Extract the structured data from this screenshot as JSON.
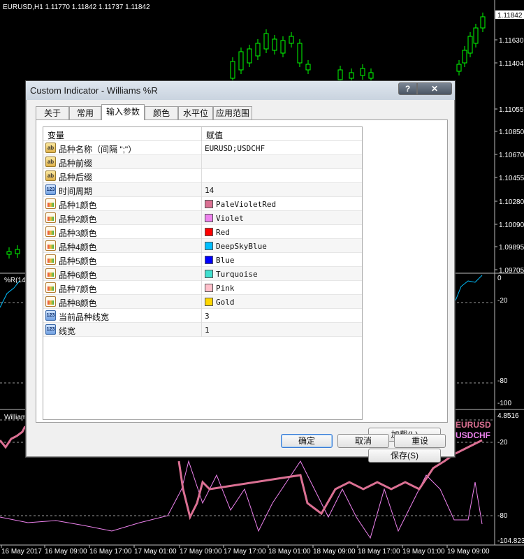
{
  "chart": {
    "header": "EURUSD,H1  1.11770 1.11842 1.11737 1.11842",
    "current_price": "1.11842",
    "price_ticks": [
      "1.11630",
      "1.11404",
      "1.11055",
      "1.10850",
      "1.10670",
      "1.10455",
      "1.10280",
      "1.10090",
      "1.09895",
      "1.09705"
    ],
    "sub1": {
      "label": "%R(14)",
      "ticks": [
        "0",
        "-20",
        "-80",
        "-100"
      ]
    },
    "sub2": {
      "label": "Williams",
      "ticks": [
        "4.8516",
        "-20",
        "-80",
        "-104.8233"
      ],
      "legend1": "EURUSD",
      "legend2": "USDCHF"
    },
    "dates": [
      "16 May 2017",
      "16 May 09:00",
      "16 May 17:00",
      "17 May 01:00",
      "17 May 09:00",
      "17 May 17:00",
      "18 May 01:00",
      "18 May 09:00",
      "18 May 17:00",
      "19 May 01:00",
      "19 May 09:00"
    ]
  },
  "dialog": {
    "title": "Custom Indicator - Williams %R",
    "help_label": "?",
    "close_label": "✕",
    "tabs": [
      "关于",
      "常用",
      "输入参数",
      "颜色",
      "水平位",
      "应用范围"
    ],
    "active_tab": "输入参数",
    "columns": {
      "variable": "变量",
      "value": "赋值"
    },
    "params": [
      {
        "icon": "text",
        "name": "品种名称（间隔 \";\"）",
        "value": "EURUSD;USDCHF"
      },
      {
        "icon": "text",
        "name": "品种前缀",
        "value": ""
      },
      {
        "icon": "text",
        "name": "品种后缀",
        "value": ""
      },
      {
        "icon": "number",
        "name": "时间周期",
        "value": "14"
      },
      {
        "icon": "color",
        "name": "品种1颜色",
        "value": "PaleVioletRed",
        "color": "#DB7093"
      },
      {
        "icon": "color",
        "name": "品种2颜色",
        "value": "Violet",
        "color": "#EE82EE"
      },
      {
        "icon": "color",
        "name": "品种3颜色",
        "value": "Red",
        "color": "#FF0000"
      },
      {
        "icon": "color",
        "name": "品种4颜色",
        "value": "DeepSkyBlue",
        "color": "#00BFFF"
      },
      {
        "icon": "color",
        "name": "品种5颜色",
        "value": "Blue",
        "color": "#0000FF"
      },
      {
        "icon": "color",
        "name": "品种6颜色",
        "value": "Turquoise",
        "color": "#40E0D0"
      },
      {
        "icon": "color",
        "name": "品种7颜色",
        "value": "Pink",
        "color": "#FFC0CB"
      },
      {
        "icon": "color",
        "name": "品种8颜色",
        "value": "Gold",
        "color": "#FFD700"
      },
      {
        "icon": "number",
        "name": "当前品种线宽",
        "value": "3"
      },
      {
        "icon": "number",
        "name": "线宽",
        "value": "1"
      }
    ],
    "icon_text_label": "ab",
    "icon_number_label": "123",
    "load_button": "加载(L)",
    "save_button": "保存(S)",
    "ok_button": "确定",
    "cancel_button": "取消",
    "reset_button": "重设"
  }
}
